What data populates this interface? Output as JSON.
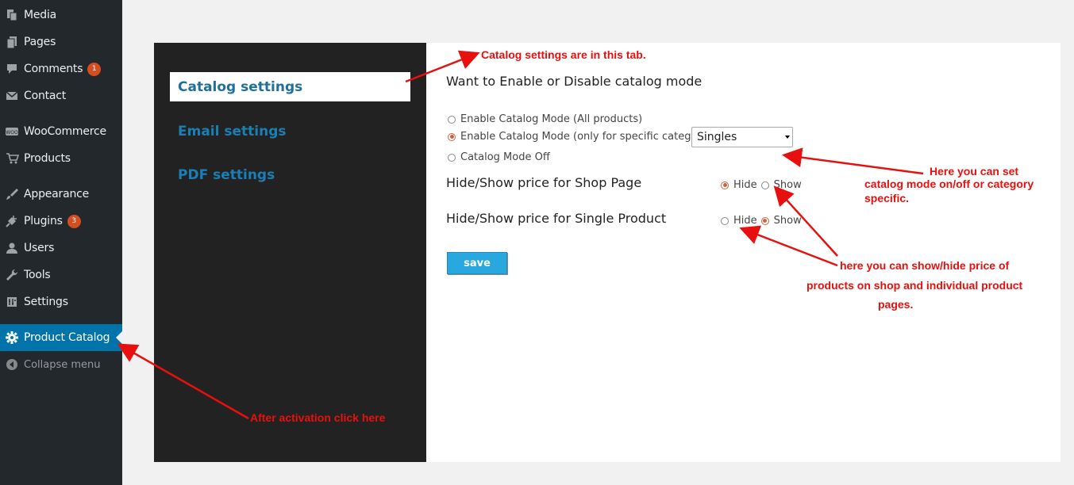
{
  "sidebar": {
    "items": [
      {
        "label": "Media",
        "icon": "media-icon"
      },
      {
        "label": "Pages",
        "icon": "pages-icon"
      },
      {
        "label": "Comments",
        "icon": "comments-icon",
        "badge": "1"
      },
      {
        "label": "Contact",
        "icon": "mail-icon"
      },
      {
        "label": "WooCommerce",
        "icon": "woocommerce-icon"
      },
      {
        "label": "Products",
        "icon": "cart-icon"
      },
      {
        "label": "Appearance",
        "icon": "brush-icon"
      },
      {
        "label": "Plugins",
        "icon": "plug-icon",
        "badge": "3"
      },
      {
        "label": "Users",
        "icon": "user-icon"
      },
      {
        "label": "Tools",
        "icon": "wrench-icon"
      },
      {
        "label": "Settings",
        "icon": "settings-sliders-icon"
      },
      {
        "label": "Product Catalog",
        "icon": "gear-icon"
      }
    ],
    "collapse_label": "Collapse menu"
  },
  "tabs": [
    {
      "label": "Catalog settings"
    },
    {
      "label": "Email settings"
    },
    {
      "label": "PDF settings"
    }
  ],
  "content": {
    "heading": "Want to Enable or Disable catalog mode",
    "catalog_options": [
      {
        "label": "Enable Catalog Mode (All products)",
        "checked": false
      },
      {
        "label": "Enable Catalog Mode (only for specific category)",
        "checked": true
      },
      {
        "label": "Catalog Mode Off",
        "checked": false
      }
    ],
    "category_select_value": "Singles",
    "shop_price_label": "Hide/Show price for Shop Page",
    "single_price_label": "Hide/Show price for Single Product",
    "hide_label": "Hide",
    "show_label": "Show",
    "save_label": "save"
  },
  "annotations": {
    "tab_note": "Catalog settings are in this tab.",
    "mode_note_1": "Here you can set",
    "mode_note_2": "catalog mode on/off or category",
    "mode_note_3": "specific.",
    "price_note_1": "here you can show/hide price of",
    "price_note_2": "products on shop and individual product",
    "price_note_3": "pages.",
    "menu_note": "After activation click here"
  },
  "colors": {
    "sidebar_bg": "#23282d",
    "current_menu_bg": "#0073aa",
    "tab_panel_bg": "#222222",
    "tab_text": "#1a7fb5",
    "save_button": "#29a8df",
    "annotation": "#e8100e"
  }
}
